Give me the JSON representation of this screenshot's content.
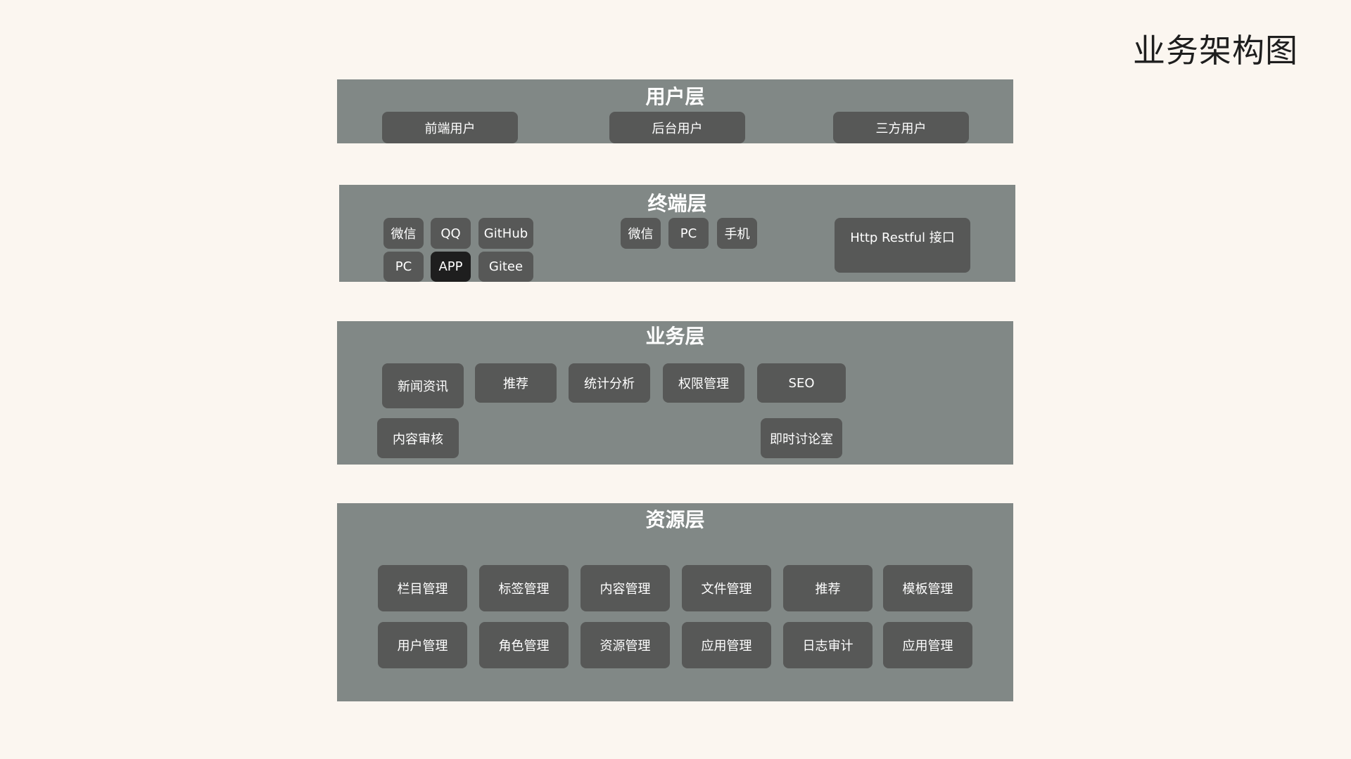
{
  "title": "业务架构图",
  "colors": {
    "background": "#fbf6f0",
    "layer_fill": "#818886",
    "chip_fill": "#575857",
    "chip_active_fill": "#1e1e1e",
    "text_light": "#ffffff"
  },
  "user_layer": {
    "title": "用户层",
    "items": [
      "前端用户",
      "后台用户",
      "三方用户"
    ]
  },
  "terminal_layer": {
    "title": "终端层",
    "group1": [
      "微信",
      "QQ",
      "GitHub",
      "PC",
      "APP",
      "Gitee"
    ],
    "group1_selected": "APP",
    "group2": [
      "微信",
      "PC",
      "手机"
    ],
    "api": "Http Restful 接口"
  },
  "business_layer": {
    "title": "业务层",
    "items": [
      "新闻资讯",
      "推荐",
      "统计分析",
      "权限管理",
      "SEO",
      "内容审核",
      "即时讨论室"
    ]
  },
  "resource_layer": {
    "title": "资源层",
    "items": [
      "栏目管理",
      "标签管理",
      "内容管理",
      "文件管理",
      "推荐",
      "模板管理",
      "用户管理",
      "角色管理",
      "资源管理",
      "应用管理",
      "日志审计",
      "应用管理"
    ]
  }
}
